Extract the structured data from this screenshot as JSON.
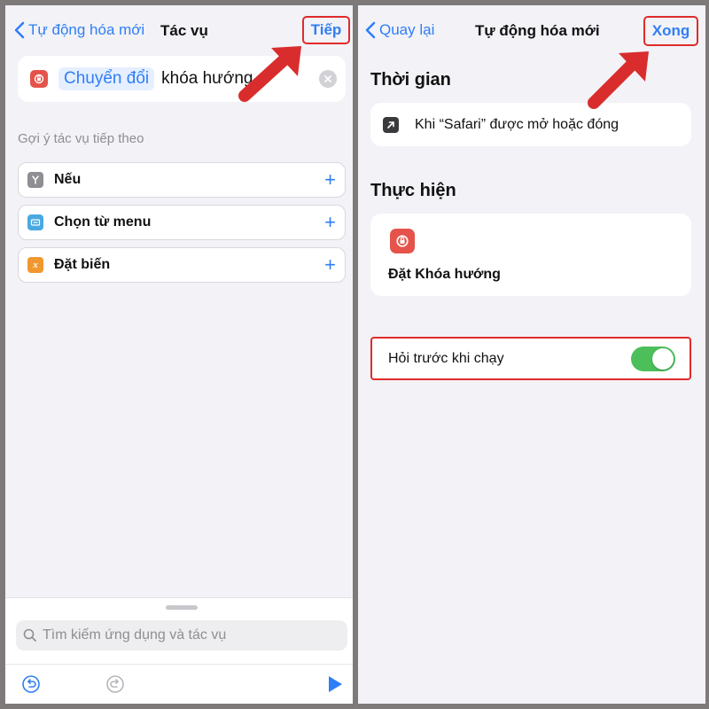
{
  "left": {
    "nav": {
      "back_label": "Tự động hóa mới",
      "title": "Tác vụ",
      "next_label": "Tiếp"
    },
    "action_input": {
      "token": "Chuyển đổi",
      "text": "khóa hướng"
    },
    "suggestions_header": "Gợi ý tác vụ tiếp theo",
    "suggestions": [
      {
        "label": "Nếu",
        "icon": "branch-icon",
        "color": "#8e8e93"
      },
      {
        "label": "Chọn từ menu",
        "icon": "menu-icon",
        "color": "#4aa8e0"
      },
      {
        "label": "Đặt biến",
        "icon": "variable-icon",
        "color": "#f0982f"
      }
    ],
    "search": {
      "placeholder": "Tìm kiếm ứng dụng và tác vụ"
    }
  },
  "right": {
    "nav": {
      "back_label": "Quay lại",
      "title": "Tự động hóa mới",
      "done_label": "Xong"
    },
    "when_header": "Thời gian",
    "trigger_text": "Khi “Safari” được mở hoặc đóng",
    "do_header": "Thực hiện",
    "action_label": "Đặt Khóa hướng",
    "ask_before_running": {
      "label": "Hỏi trước khi chạy",
      "on": true
    }
  },
  "colors": {
    "accent": "#2f7ef5",
    "highlight": "#e02b2b",
    "toggle_on": "#4cbf5a",
    "app_icon": "#e5534b"
  }
}
